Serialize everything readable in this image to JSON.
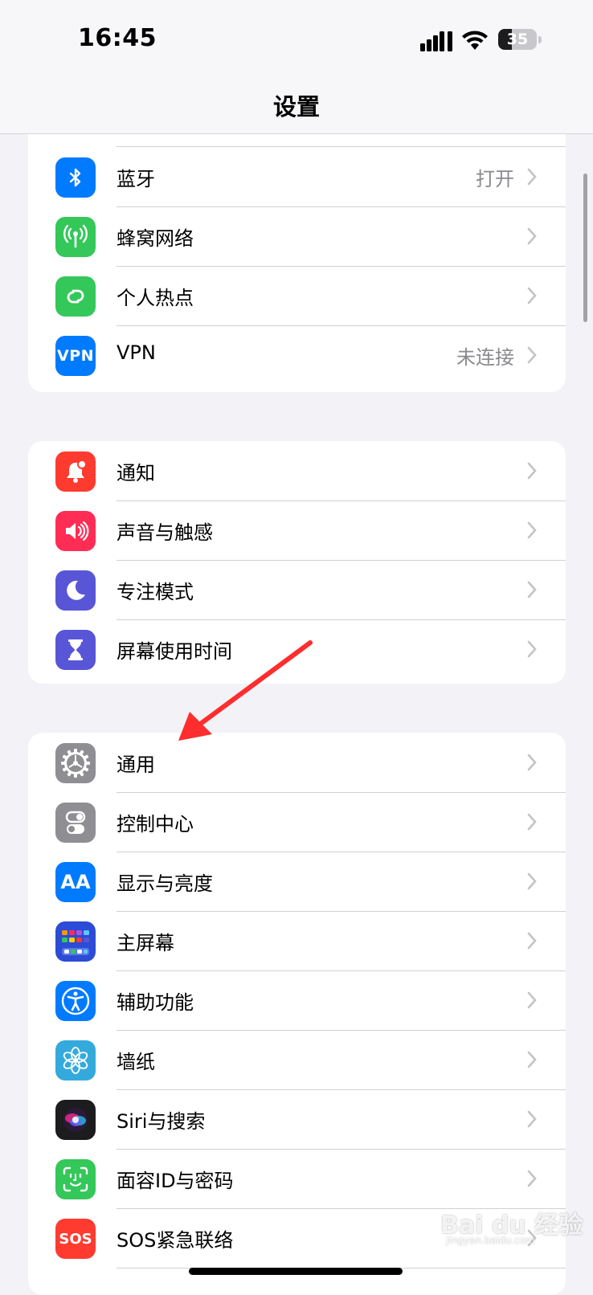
{
  "status_bar": {
    "time": "16:45",
    "battery_level": "35",
    "battery_fraction": 0.35
  },
  "navbar": {
    "title": "设置"
  },
  "groups": [
    {
      "items": [
        {
          "label": "蓝牙",
          "value": "打开",
          "icon": "bluetooth-icon",
          "color": "#007aff"
        },
        {
          "label": "蜂窝网络",
          "value": "",
          "icon": "antenna-icon",
          "color": "#34c759"
        },
        {
          "label": "个人热点",
          "value": "",
          "icon": "hotspot-icon",
          "color": "#34c759"
        },
        {
          "label": "VPN",
          "value": "未连接",
          "icon": "vpn-icon",
          "icon_text": "VPN",
          "color": "#007aff"
        }
      ]
    },
    {
      "items": [
        {
          "label": "通知",
          "icon": "bell-icon",
          "color": "#ff3b30"
        },
        {
          "label": "声音与触感",
          "icon": "speaker-icon",
          "color": "#ff2d55"
        },
        {
          "label": "专注模式",
          "icon": "moon-icon",
          "color": "#5856d6"
        },
        {
          "label": "屏幕使用时间",
          "icon": "hourglass-icon",
          "color": "#5856d6"
        }
      ]
    },
    {
      "items": [
        {
          "label": "通用",
          "icon": "gear-icon",
          "color": "#8e8e93"
        },
        {
          "label": "控制中心",
          "icon": "toggles-icon",
          "color": "#8e8e93"
        },
        {
          "label": "显示与亮度",
          "icon": "text-size-icon",
          "icon_text": "AA",
          "color": "#007aff"
        },
        {
          "label": "主屏幕",
          "icon": "home-screen-icon",
          "color": "#2c4bd6"
        },
        {
          "label": "辅助功能",
          "icon": "accessibility-icon",
          "color": "#007aff"
        },
        {
          "label": "墙纸",
          "icon": "flower-icon",
          "color": "#34aadc"
        },
        {
          "label": "Siri与搜索",
          "icon": "siri-icon",
          "color": "#1c1c1e"
        },
        {
          "label": "面容ID与密码",
          "icon": "face-id-icon",
          "color": "#34c759"
        },
        {
          "label": "SOS紧急联络",
          "icon": "sos-icon",
          "icon_text": "SOS",
          "color": "#ff3b30"
        }
      ]
    }
  ],
  "watermark": {
    "text": "Bai du 经验",
    "sub": "jingyan.baidu.com"
  }
}
